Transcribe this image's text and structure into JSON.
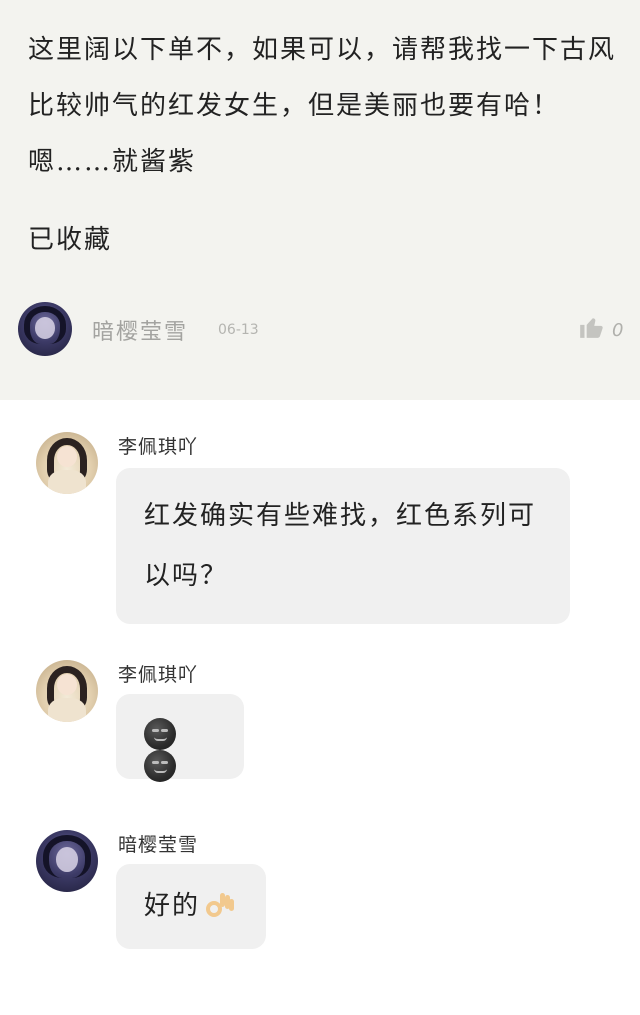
{
  "post": {
    "text": "这里阔以下单不，如果可以，请帮我找一下古风比较帅气的红发女生，但是美丽也要有哈！嗯……就酱紫",
    "collected": "已收藏",
    "author": "暗樱莹雪",
    "date": "06-13",
    "likes": "0"
  },
  "replies": [
    {
      "name": "李佩琪吖",
      "message": "红发确实有些难找，红色系列可以吗？"
    },
    {
      "name": "李佩琪吖",
      "emoji": [
        "smirk-face",
        "smirk-face"
      ]
    },
    {
      "name": "暗樱莹雪",
      "message": "好的",
      "emoji": [
        "ok-hand"
      ]
    }
  ],
  "colors": {
    "top_background": "#f3f3ef",
    "bubble_background": "#f0f0f0",
    "muted_text": "#a3a3a0"
  }
}
